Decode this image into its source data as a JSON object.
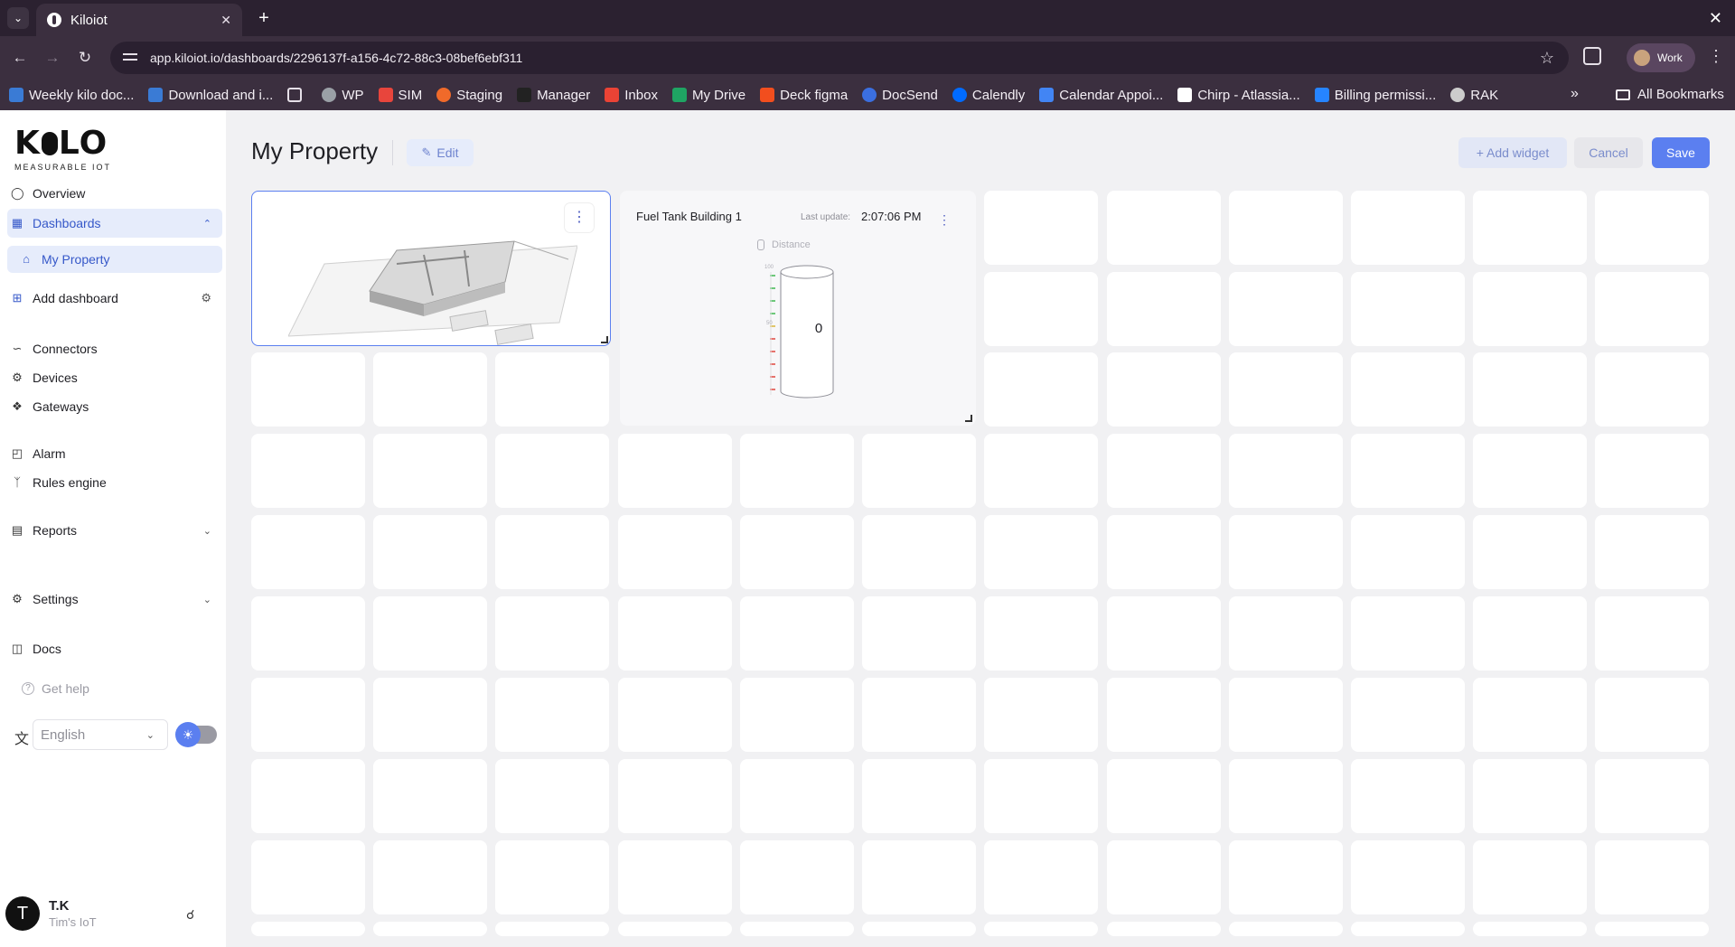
{
  "browser": {
    "tab_title": "Kiloiot",
    "url": "app.kiloiot.io/dashboards/2296137f-a156-4c72-88c3-08bef6ebf311",
    "profile_label": "Work",
    "bookmarks": [
      {
        "label": "Weekly kilo doc...",
        "color": "#3a7bd5"
      },
      {
        "label": "Download and i...",
        "color": "#3a7bd5"
      },
      {
        "label": "",
        "color": "#e6e0e8"
      },
      {
        "label": "WP",
        "color": "#9aa0a6"
      },
      {
        "label": "SIM",
        "color": "#e8453c"
      },
      {
        "label": "Staging",
        "color": "#f06a2a"
      },
      {
        "label": "Manager",
        "color": "#222222"
      },
      {
        "label": "Inbox",
        "color": "#ea4335"
      },
      {
        "label": "My Drive",
        "color": "#1fa463"
      },
      {
        "label": "Deck figma",
        "color": "#f24e1e"
      },
      {
        "label": "DocSend",
        "color": "#3b6fe0"
      },
      {
        "label": "Calendly",
        "color": "#006bff"
      },
      {
        "label": "Calendar Appoi...",
        "color": "#4285f4"
      },
      {
        "label": "Chirp - Atlassia...",
        "color": "#ffffff"
      },
      {
        "label": "Billing permissi...",
        "color": "#2684ff"
      },
      {
        "label": "RAK",
        "color": "#cccccc"
      }
    ],
    "more_bookmarks": "»",
    "all_bookmarks": "All Bookmarks"
  },
  "sidebar": {
    "logo": "K",
    "logo_o": "O",
    "logo_lo": "LO",
    "logo_sub": "MEASURABLE IOT",
    "overview": "Overview",
    "dashboards": "Dashboards",
    "my_property": "My Property",
    "add_dashboard": "Add dashboard",
    "connectors": "Connectors",
    "devices": "Devices",
    "gateways": "Gateways",
    "alarm": "Alarm",
    "rules_engine": "Rules engine",
    "reports": "Reports",
    "settings": "Settings",
    "docs": "Docs",
    "get_help": "Get help",
    "language": "English",
    "user_initial": "T",
    "user_name": "T.K",
    "user_org": "Tim's IoT"
  },
  "header": {
    "title": "My Property",
    "edit": "Edit",
    "add_widget": "+ Add widget",
    "cancel": "Cancel",
    "save": "Save"
  },
  "fuel_widget": {
    "title": "Fuel Tank Building 1",
    "last_update_label": "Last update:",
    "last_update_time": "2:07:06 PM",
    "metric_label": "Distance",
    "value": "0",
    "gauge_top_label": "100",
    "gauge_mid_label": "50"
  },
  "colors": {
    "accent": "#5b7ff0",
    "active_bg": "#e6ecfb",
    "gauge_green": "#3fb950",
    "gauge_yellow": "#d9b53a",
    "gauge_red": "#e0453c"
  }
}
